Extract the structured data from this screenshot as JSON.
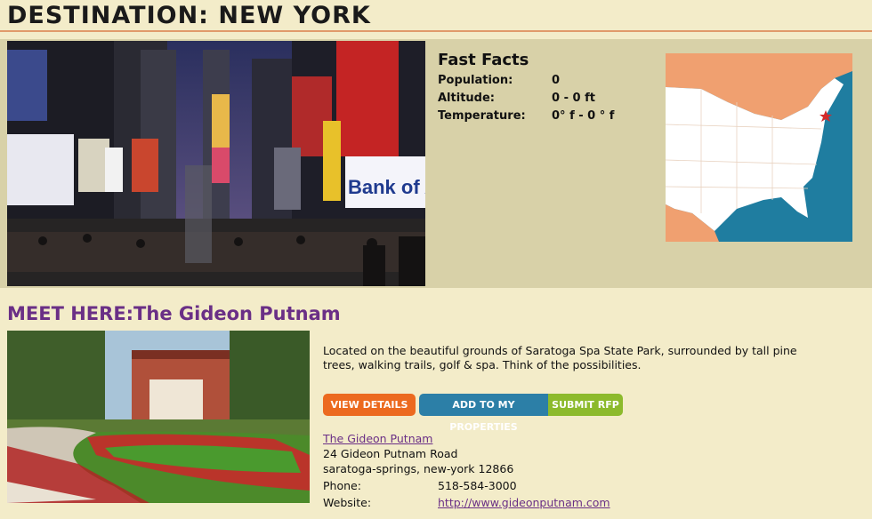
{
  "header": {
    "title": "DESTINATION: NEW YORK"
  },
  "facts": {
    "title": "Fast Facts",
    "rows": [
      {
        "label": "Population:",
        "value": "0"
      },
      {
        "label": "Altitude:",
        "value": "0 - 0 ft"
      },
      {
        "label": "Temperature:",
        "value": "0° f - 0 ° f"
      }
    ]
  },
  "photo_sign": "Bank of Ame",
  "meet": {
    "title": "MEET HERE:The Gideon Putnam",
    "description": "Located on the beautiful grounds of Saratoga Spa State Park, surrounded by tall pine trees, walking trails, golf & spa.  Think of the possibilities.",
    "buttons": {
      "view": "VIEW DETAILS",
      "add": "ADD TO MY PROPERTIES",
      "rfp": "SUBMIT RFP"
    },
    "hotel_name": "The Gideon Putnam",
    "address1": "24 Gideon Putnam Road",
    "address2": "saratoga-springs, new-york 12866",
    "phone_label": "Phone:",
    "phone": "518-584-3000",
    "website_label": "Website:",
    "website": "http://www.gideonputnam.com"
  },
  "colors": {
    "accent_orange": "#ec6a1f",
    "accent_blue": "#2c7fa7",
    "accent_green": "#8cba2c",
    "title_purple": "#6a2f86",
    "map_star": "#d42a2a"
  }
}
